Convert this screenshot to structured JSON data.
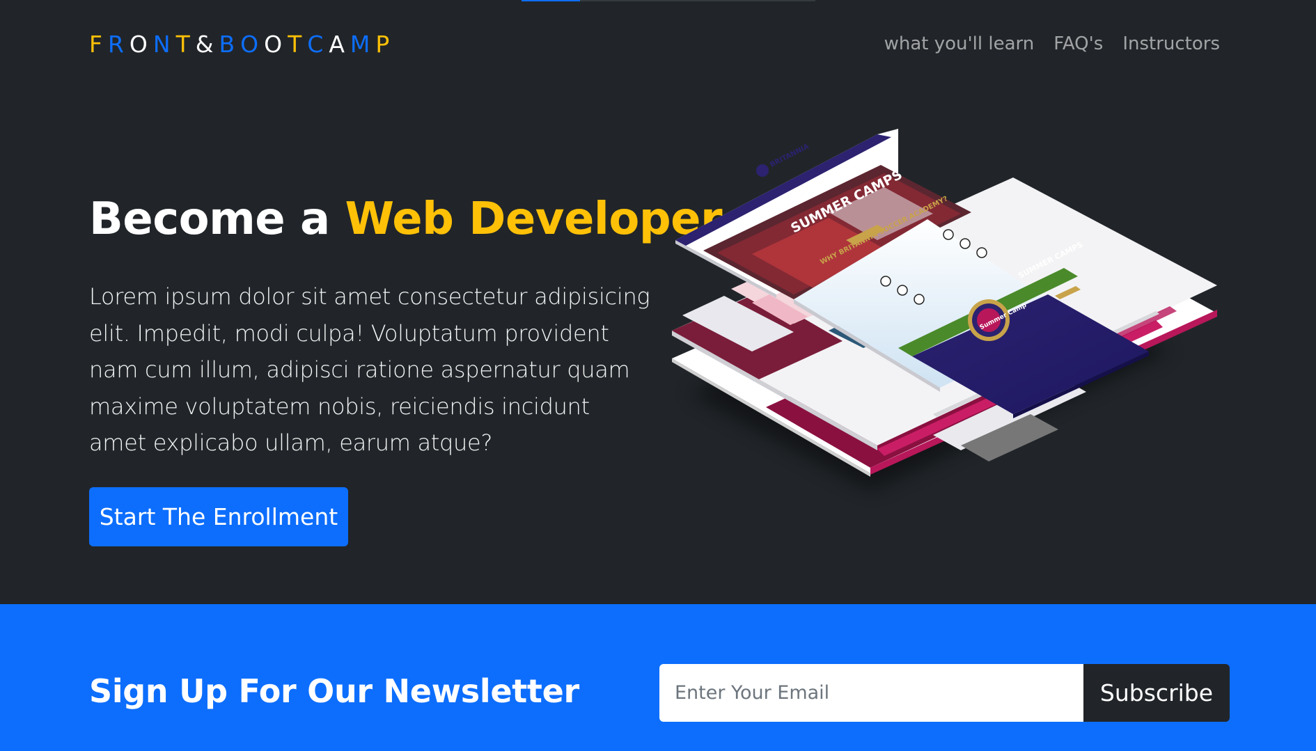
{
  "brand": {
    "letters": [
      {
        "char": "F",
        "color": "#ffc107"
      },
      {
        "char": "R",
        "color": "#0d6efd"
      },
      {
        "char": "O",
        "color": "#ffffff"
      },
      {
        "char": "N",
        "color": "#0d6efd"
      },
      {
        "char": "T",
        "color": "#ffc107"
      },
      {
        "char": "&",
        "color": "#ffffff"
      },
      {
        "char": "B",
        "color": "#0d6efd"
      },
      {
        "char": "O",
        "color": "#0d6efd"
      },
      {
        "char": "O",
        "color": "#ffffff"
      },
      {
        "char": "T",
        "color": "#ffc107"
      },
      {
        "char": "C",
        "color": "#0d6efd"
      },
      {
        "char": "A",
        "color": "#ffffff"
      },
      {
        "char": "M",
        "color": "#0d6efd"
      },
      {
        "char": "P",
        "color": "#ffc107"
      }
    ]
  },
  "nav": {
    "items": [
      {
        "label": "what you'll learn"
      },
      {
        "label": "FAQ's"
      },
      {
        "label": "Instructors"
      }
    ]
  },
  "hero": {
    "title_prefix": "Become a ",
    "title_highlight": "Web Developer",
    "paragraph": "Lorem ipsum dolor sit amet consectetur adipisicing elit. Impedit, modi culpa! Voluptatum provident nam cum illum, adipisci ratione aspernatur quam maxime voluptatem nobis, reiciendis incidunt amet explicabo ullam, earum atque?",
    "cta_label": "Start The Enrollment"
  },
  "illustration": {
    "top_heading": "SUMMER CAMPS",
    "mid_heading": "WHY BRITANNIA SOCCER ACADEMY?",
    "badge_text": "Summer Camp",
    "purple_heading": "SUMMER CAMPS",
    "brand_text": "BRITANNIA",
    "colors": {
      "purple": "#2c2270",
      "magenta": "#b8175a",
      "grass": "#4a8a2a",
      "sky": "#cfe3f3",
      "gold": "#c8a34a"
    }
  },
  "newsletter": {
    "title": "Sign Up For Our Newsletter",
    "email_placeholder": "Enter Your Email",
    "subscribe_label": "Subscribe"
  },
  "colors": {
    "background": "#212529",
    "primary": "#0d6efd",
    "warning": "#ffc107"
  }
}
